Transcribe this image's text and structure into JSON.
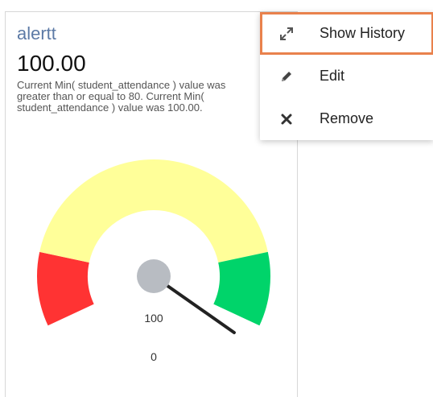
{
  "widget": {
    "title": "alertt",
    "value": "100.00",
    "description_lines": [
      "Current Min( student_attendance ) value was",
      "greater than or equal to 80. Current Min(",
      "student_attendance ) value was 100.00."
    ],
    "gauge": {
      "needle_label": "100",
      "min_label": "0",
      "value": 100,
      "colors": {
        "low": "#ff3333",
        "mid": "#ffff99",
        "high": "#00d46a",
        "needle": "#222222",
        "hub": "#b8bcc2"
      }
    }
  },
  "context_menu": {
    "items": [
      {
        "label": "Show History",
        "icon": "expand-arrows-icon",
        "highlighted": true
      },
      {
        "label": "Edit",
        "icon": "pencil-icon",
        "highlighted": false
      },
      {
        "label": "Remove",
        "icon": "close-x-icon",
        "highlighted": false
      }
    ]
  }
}
